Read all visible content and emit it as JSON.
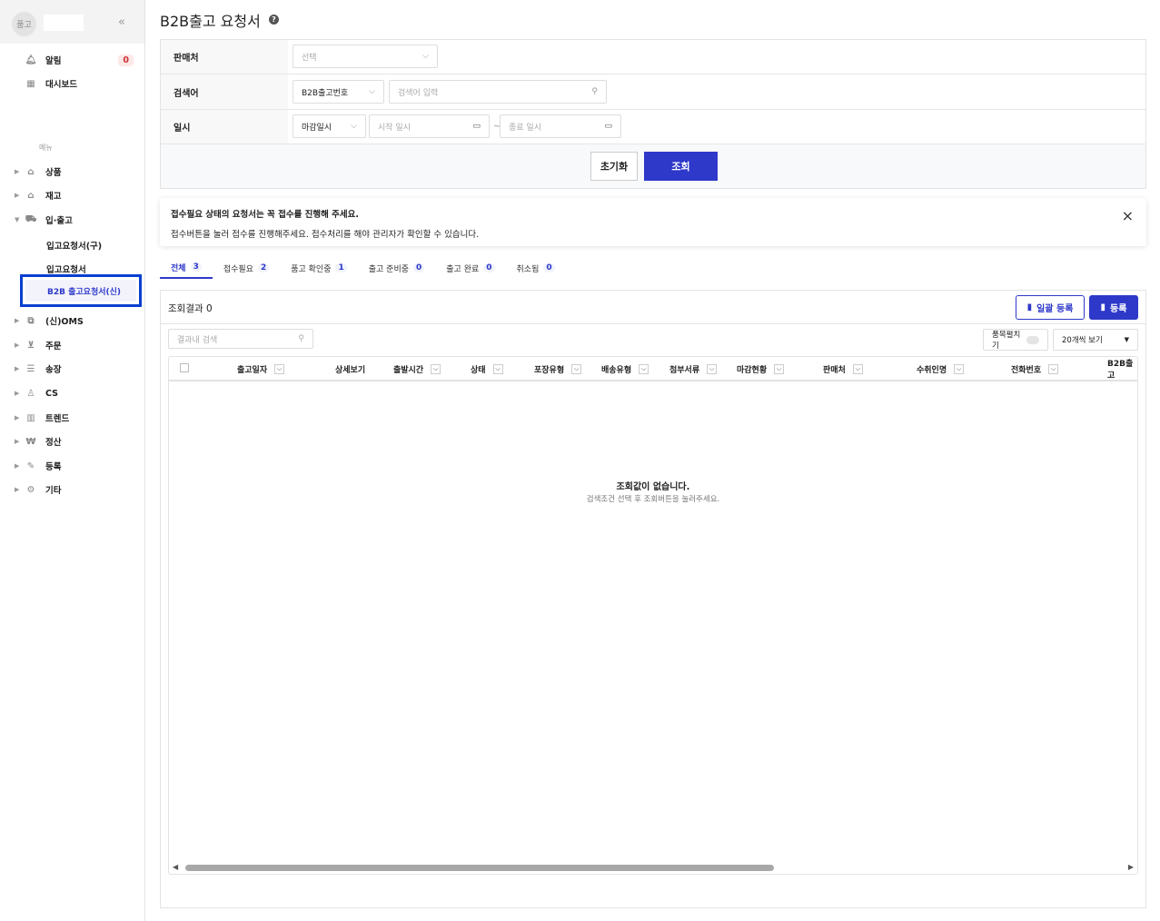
{
  "sidebar": {
    "avatar": "품고",
    "collapse": "«",
    "alerts_label": "알림",
    "alerts_count": "0",
    "dashboard": "대시보드",
    "menu_header": "메뉴",
    "items": [
      {
        "label": "상품",
        "icon": "bag-icon"
      },
      {
        "label": "재고",
        "icon": "warehouse-icon"
      },
      {
        "label": "입·출고",
        "icon": "truck-icon"
      },
      {
        "label": "(신)OMS",
        "icon": "oms-icon"
      },
      {
        "label": "주문",
        "icon": "cart-icon"
      },
      {
        "label": "송장",
        "icon": "invoice-icon"
      },
      {
        "label": "CS",
        "icon": "person-icon"
      },
      {
        "label": "트렌드",
        "icon": "chart-icon"
      },
      {
        "label": "정산",
        "icon": "won-icon"
      },
      {
        "label": "등록",
        "icon": "pencil-icon"
      },
      {
        "label": "기타",
        "icon": "gear-icon"
      }
    ],
    "subitems": [
      "입고요청서(구)",
      "입고요청서",
      "B2B 출고요청서(신)"
    ]
  },
  "page": {
    "title": "B2B출고 요청서",
    "help": "?"
  },
  "filter": {
    "seller_label": "판매처",
    "seller_placeholder": "선택",
    "keyword_label": "검색어",
    "keyword_type": "B2B출고번호",
    "keyword_placeholder": "검색어 입력",
    "date_label": "일시",
    "date_type": "마감일시",
    "start_placeholder": "시작 일시",
    "tilde": "~",
    "end_placeholder": "종료 일시",
    "reset": "초기화",
    "search": "조회"
  },
  "notice": {
    "line1": "접수필요 상태의 요청서는 꼭 접수를 진행해 주세요.",
    "line2": "접수버튼을 눌러 접수를 진행해주세요. 접수처리를 해야 관리자가 확인할 수 있습니다.",
    "close": "×"
  },
  "tabs": [
    {
      "label": "전체",
      "count": "3"
    },
    {
      "label": "접수필요",
      "count": "2"
    },
    {
      "label": "품고 확인중",
      "count": "1"
    },
    {
      "label": "출고 준비중",
      "count": "0"
    },
    {
      "label": "출고 완료",
      "count": "0"
    },
    {
      "label": "취소됨",
      "count": "0"
    }
  ],
  "grid": {
    "result": "조회결과 0",
    "bulk_register": "일괄 등록",
    "register": "등록",
    "search_placeholder": "결과내 검색",
    "expand_label": "품목펼치기",
    "page_size": "20개씩 보기",
    "columns": [
      "출고일자",
      "상세보기",
      "출발시간",
      "상태",
      "포장유형",
      "배송유형",
      "첨부서류",
      "마감현황",
      "판매처",
      "수취인명",
      "전화번호",
      "B2B출고"
    ],
    "empty_title": "조회값이 없습니다.",
    "empty_sub": "검색조건 선택 후 조회버튼을 눌러주세요."
  },
  "colors": {
    "accent": "#2e39c9",
    "highlight": "#0a3fd0"
  }
}
